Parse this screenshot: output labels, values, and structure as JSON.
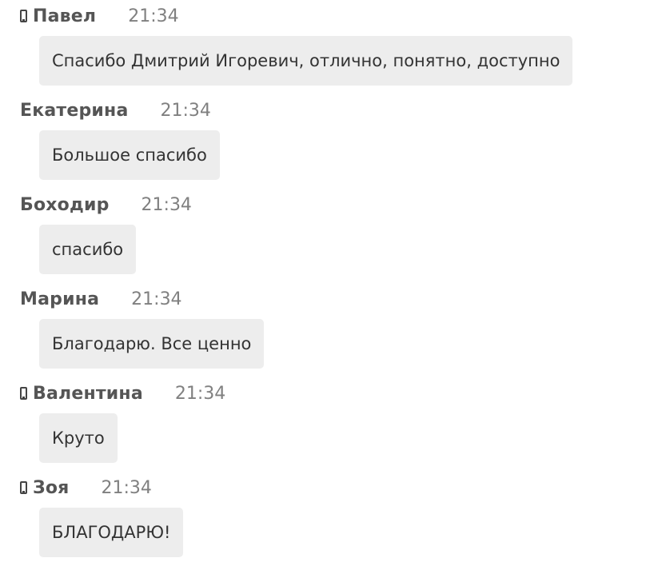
{
  "messages": [
    {
      "author": "Павел",
      "time": "21:34",
      "text": "Спасибо Дмитрий Игоревич, отлично, понятно, доступно",
      "mobile": true
    },
    {
      "author": "Екатерина",
      "time": "21:34",
      "text": "Большое спасибо",
      "mobile": false
    },
    {
      "author": "Боходир",
      "time": "21:34",
      "text": "спасибо",
      "mobile": false
    },
    {
      "author": "Марина",
      "time": "21:34",
      "text": "Благодарю. Все ценно",
      "mobile": false
    },
    {
      "author": "Валентина",
      "time": "21:34",
      "text": "Круто",
      "mobile": true
    },
    {
      "author": "Зоя",
      "time": "21:34",
      "text": "БЛАГОДАРЮ!",
      "mobile": true
    }
  ],
  "icons": {
    "mobile": "mobile-phone-icon"
  },
  "colors": {
    "bubble_background": "#ededed",
    "author": "#555555",
    "time": "#808080",
    "text": "#333333"
  }
}
